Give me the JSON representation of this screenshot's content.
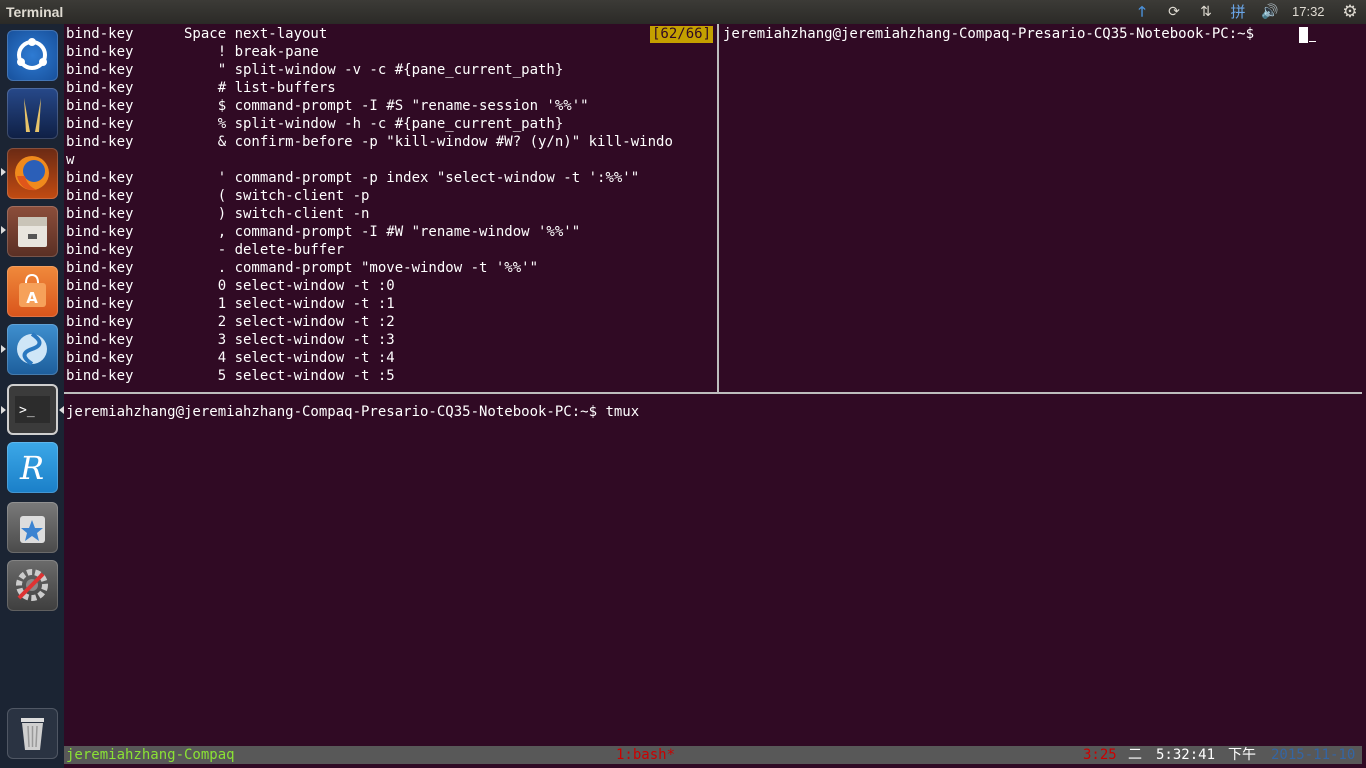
{
  "window_title": "Terminal",
  "clock": "17:32",
  "tray_icons": [
    "upload-arrow-icon",
    "sync-icon",
    "network-icon",
    "input-method-icon",
    "volume-icon",
    "settings-gear-icon"
  ],
  "tray_glyphs": [
    "🡑",
    "⟳",
    "⇅",
    "拼",
    "🔊",
    "⚙"
  ],
  "launcher": [
    "dash-home-icon",
    "text-editor-icon",
    "firefox-icon",
    "file-manager-icon",
    "software-center-icon",
    "browser-app-icon",
    "terminal-icon",
    "r-app-icon",
    "starred-app-icon",
    "system-settings-icon",
    "trash-icon"
  ],
  "left_pane_lines": [
    "bind-key      Space next-layout",
    "bind-key          ! break-pane",
    "bind-key          \" split-window -v -c #{pane_current_path}",
    "bind-key          # list-buffers",
    "bind-key          $ command-prompt -I #S \"rename-session '%%'\"",
    "bind-key          % split-window -h -c #{pane_current_path}",
    "bind-key          & confirm-before -p \"kill-window #W? (y/n)\" kill-windo",
    "w",
    "bind-key          ' command-prompt -p index \"select-window -t ':%%'\"",
    "bind-key          ( switch-client -p",
    "bind-key          ) switch-client -n",
    "bind-key          , command-prompt -I #W \"rename-window '%%'\"",
    "bind-key          - delete-buffer",
    "bind-key          . command-prompt \"move-window -t '%%'\"",
    "bind-key          0 select-window -t :0",
    "bind-key          1 select-window -t :1",
    "bind-key          2 select-window -t :2",
    "bind-key          3 select-window -t :3",
    "bind-key          4 select-window -t :4",
    "bind-key          5 select-window -t :5"
  ],
  "position_indicator": "[62/66]",
  "right_pane_prompt": "jeremiahzhang@jeremiahzhang-Compaq-Presario-CQ35-Notebook-PC:~$ ",
  "bottom_pane_prompt": "jeremiahzhang@jeremiahzhang-Compaq-Presario-CQ35-Notebook-PC:~$ tmux",
  "status_bar": {
    "session": "jeremiahzhang-Compaq",
    "window": "1:bash*",
    "uptime": "3:25",
    "weekday": "二",
    "time": "5:32:41",
    "ampm": "下午",
    "date": "2015-11-10"
  },
  "colors": {
    "terminal_bg": "#300a24",
    "status_bg": "#585858",
    "session_fg": "#8ae234",
    "window_fg": "#cc0000",
    "date_fg": "#3465a4",
    "indicator_bg": "#c4a000"
  }
}
